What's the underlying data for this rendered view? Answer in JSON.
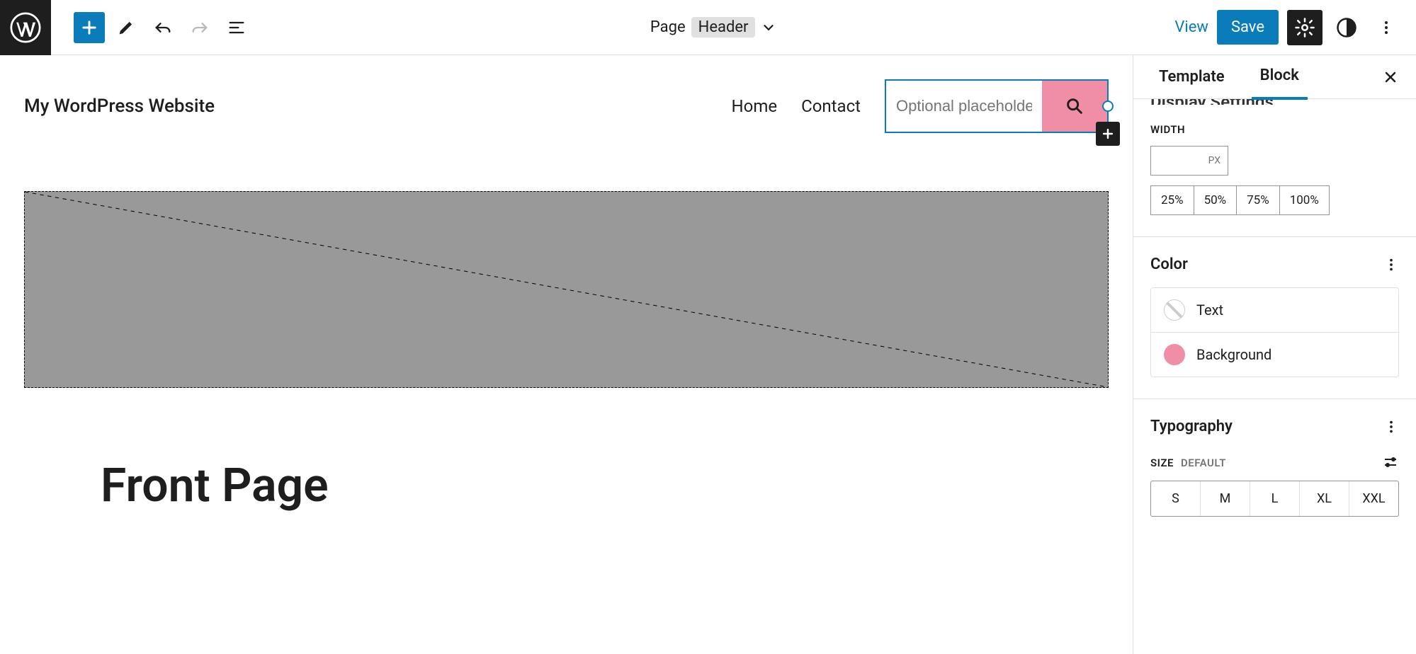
{
  "topbar": {
    "doc_type": "Page",
    "template_part": "Header",
    "view": "View",
    "save": "Save"
  },
  "header": {
    "site_title": "My WordPress Website",
    "nav": [
      "Home",
      "Contact"
    ],
    "search_placeholder": "Optional placeholder…"
  },
  "content": {
    "page_title": "Front Page"
  },
  "sidebar": {
    "tabs": [
      "Template",
      "Block"
    ],
    "active_tab": "Block",
    "section_cutoff": "Display Settings",
    "width": {
      "label": "WIDTH",
      "unit": "PX",
      "presets": [
        "25%",
        "50%",
        "75%",
        "100%"
      ]
    },
    "color": {
      "title": "Color",
      "rows": [
        {
          "label": "Text",
          "swatch": "none"
        },
        {
          "label": "Background",
          "swatch": "pink",
          "hex": "#f08ea5"
        }
      ]
    },
    "typography": {
      "title": "Typography",
      "size_label": "SIZE",
      "size_default": "DEFAULT",
      "sizes": [
        "S",
        "M",
        "L",
        "XL",
        "XXL"
      ]
    }
  }
}
